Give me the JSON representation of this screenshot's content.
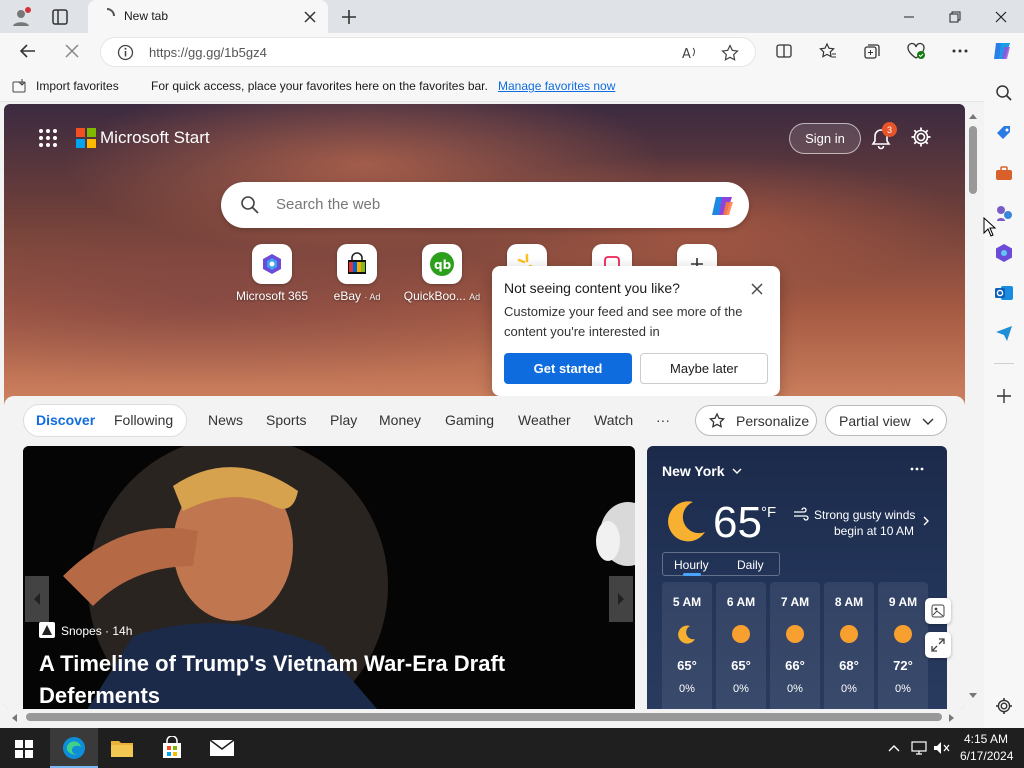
{
  "browser": {
    "tab_title": "New tab",
    "url": "https://gg.gg/1b5gz4"
  },
  "favorites_bar": {
    "import_label": "Import favorites",
    "message": "For quick access, place your favorites here on the favorites bar.",
    "manage_link": "Manage favorites now"
  },
  "header": {
    "brand": "Microsoft Start",
    "sign_in": "Sign in",
    "notification_count": "3"
  },
  "search": {
    "placeholder": "Search the web"
  },
  "quick_links": [
    {
      "label": "Microsoft 365",
      "ad": "",
      "icon": "microsoft-365-icon"
    },
    {
      "label": "eBay",
      "ad": "· Ad",
      "icon": "ebay-icon"
    },
    {
      "label": "QuickBoo...",
      "ad": "Ad",
      "icon": "quickbooks-icon"
    }
  ],
  "popup": {
    "title": "Not seeing content you like?",
    "body": "Customize your feed and see more of the content you're interested in",
    "primary": "Get started",
    "secondary": "Maybe later"
  },
  "feed_nav": {
    "discover": "Discover",
    "following": "Following",
    "items": [
      "News",
      "Sports",
      "Play",
      "Money",
      "Gaming",
      "Weather",
      "Watch"
    ],
    "more": "···",
    "personalize": "Personalize",
    "partial_view": "Partial view"
  },
  "hero": {
    "source": "Snopes · 14h",
    "title": "A Timeline of Trump's Vietnam War-Era Draft Deferments"
  },
  "weather": {
    "location": "New York",
    "temp": "65",
    "unit": "°F",
    "alert_line1": "Strong gusty winds",
    "alert_line2": "begin at 10 AM",
    "tab_hourly": "Hourly",
    "tab_daily": "Daily",
    "hours": [
      {
        "time": "5 AM",
        "temp": "65°",
        "precip": "0%",
        "icon": "moon"
      },
      {
        "time": "6 AM",
        "temp": "65°",
        "precip": "0%",
        "icon": "sun"
      },
      {
        "time": "7 AM",
        "temp": "66°",
        "precip": "0%",
        "icon": "sun"
      },
      {
        "time": "8 AM",
        "temp": "68°",
        "precip": "0%",
        "icon": "sun"
      },
      {
        "time": "9 AM",
        "temp": "72°",
        "precip": "0%",
        "icon": "sun"
      }
    ]
  },
  "taskbar": {
    "time": "4:15 AM",
    "date": "6/17/2024"
  },
  "colors": {
    "accent": "#0f6cdf",
    "link": "#0f6cdf"
  }
}
